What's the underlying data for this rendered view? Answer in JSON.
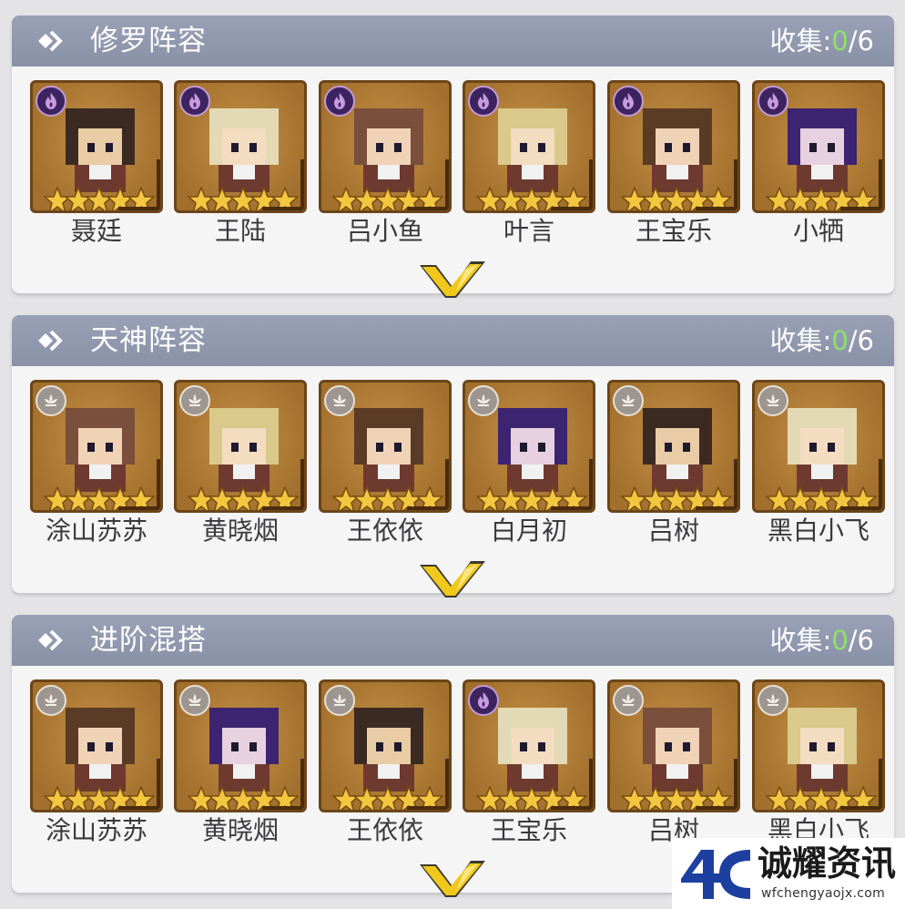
{
  "sections": [
    {
      "title": "修罗阵容",
      "collect_label": "收集:",
      "collect_count": "0",
      "collect_total": "/6",
      "characters": [
        {
          "name": "聂廷",
          "badge": "flame",
          "stars": 5
        },
        {
          "name": "王陆",
          "badge": "flame",
          "stars": 5
        },
        {
          "name": "吕小鱼",
          "badge": "flame",
          "stars": 5
        },
        {
          "name": "叶言",
          "badge": "flame",
          "stars": 5
        },
        {
          "name": "王宝乐",
          "badge": "flame",
          "stars": 5
        },
        {
          "name": "小牺",
          "badge": "flame",
          "stars": 5
        }
      ]
    },
    {
      "title": "天神阵容",
      "collect_label": "收集:",
      "collect_count": "0",
      "collect_total": "/6",
      "characters": [
        {
          "name": "涂山苏苏",
          "badge": "lotus",
          "stars": 5
        },
        {
          "name": "黄晓烟",
          "badge": "lotus",
          "stars": 5
        },
        {
          "name": "王依依",
          "badge": "lotus",
          "stars": 5
        },
        {
          "name": "白月初",
          "badge": "lotus",
          "stars": 5
        },
        {
          "name": "吕树",
          "badge": "lotus",
          "stars": 5
        },
        {
          "name": "黑白小飞",
          "badge": "lotus",
          "stars": 5
        }
      ]
    },
    {
      "title": "进阶混搭",
      "collect_label": "收集:",
      "collect_count": "0",
      "collect_total": "/6",
      "characters": [
        {
          "name": "涂山苏苏",
          "badge": "lotus",
          "stars": 5
        },
        {
          "name": "黄晓烟",
          "badge": "lotus",
          "stars": 5
        },
        {
          "name": "王依依",
          "badge": "lotus",
          "stars": 5
        },
        {
          "name": "王宝乐",
          "badge": "flame",
          "stars": 5
        },
        {
          "name": "吕树",
          "badge": "lotus",
          "stars": 5
        },
        {
          "name": "黑白小飞",
          "badge": "lotus",
          "stars": 5
        }
      ]
    }
  ],
  "watermark": {
    "name": "诚耀资讯",
    "url": "wfchengyaojx.com"
  },
  "colors": {
    "header_bg": "#8f97ac",
    "collect_count": "#8ee06a",
    "card_bg": "#b07a35",
    "card_border": "#6b4519",
    "star": "#f3c63f",
    "expand_chevron": "#f0c81c",
    "watermark_blue": "#1c3fa0"
  },
  "icons": {
    "section_header": "diamond-arrow-icon",
    "flame_badge": "flame-icon",
    "lotus_badge": "lotus-icon",
    "star": "star-icon",
    "expand": "chevron-down-icon"
  }
}
